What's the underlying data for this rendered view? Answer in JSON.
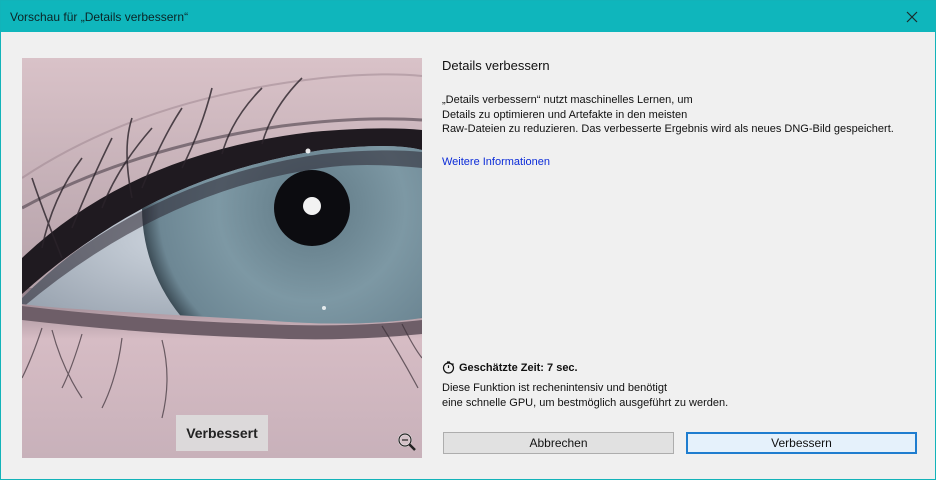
{
  "window": {
    "title": "Vorschau für „Details verbessern“"
  },
  "preview": {
    "overlay_label": "Verbessert"
  },
  "info": {
    "heading": "Details verbessern",
    "description_lines": [
      "„Details verbessern“ nutzt maschinelles Lernen, um",
      "Details zu optimieren und Artefakte in den meisten",
      "Raw-Dateien zu reduzieren. Das verbesserte Ergebnis wird als neues DNG-Bild gespeichert."
    ],
    "link": "Weitere Informationen",
    "estimated_time": "Geschätzte Zeit: 7 sec.",
    "gpu_note_lines": [
      "Diese Funktion ist rechenintensiv und benötigt",
      "eine schnelle GPU, um bestmöglich ausgeführt zu werden."
    ]
  },
  "buttons": {
    "cancel": "Abbrechen",
    "enhance": "Verbessern"
  },
  "icons": {
    "close": "close-icon",
    "zoom": "zoom-icon",
    "timer": "stopwatch-icon"
  },
  "colors": {
    "titlebar": "#0fb6bc",
    "link": "#0b2bd8",
    "primary_button_border": "#1f7dcf"
  }
}
